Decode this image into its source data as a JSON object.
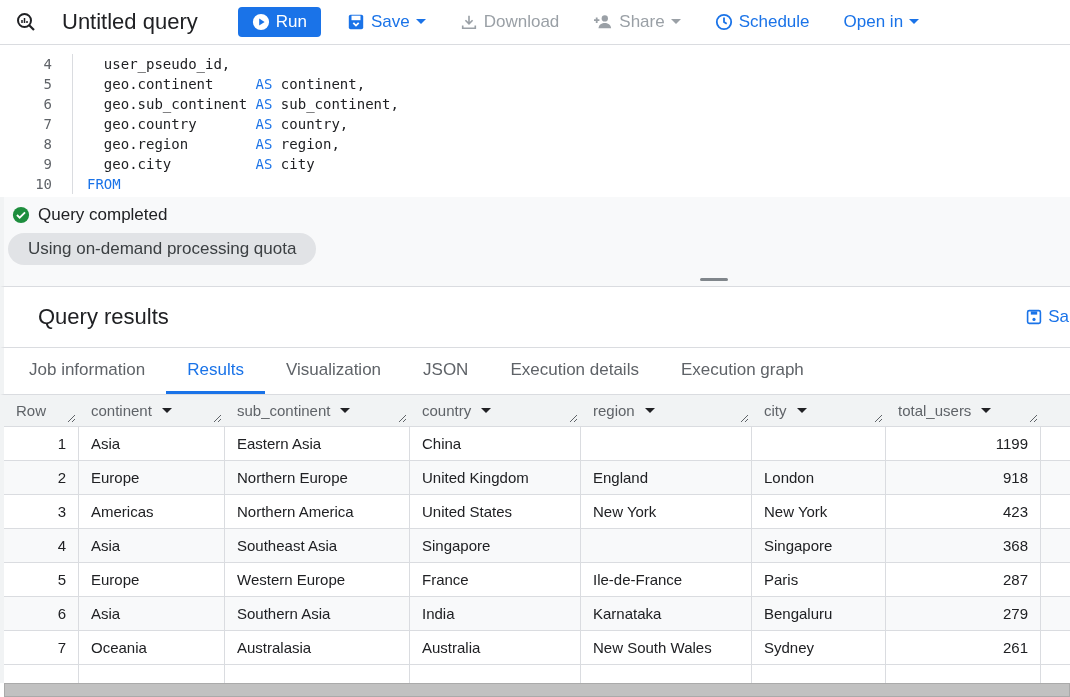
{
  "toolbar": {
    "title": "Untitled query",
    "buttons": [
      {
        "kind": "run",
        "label": "Run",
        "disabled": false,
        "caret": false
      },
      {
        "kind": "save",
        "label": "Save",
        "disabled": false,
        "caret": true
      },
      {
        "kind": "download",
        "label": "Download",
        "disabled": true,
        "caret": false
      },
      {
        "kind": "share",
        "label": "Share",
        "disabled": true,
        "caret": true
      },
      {
        "kind": "schedule",
        "label": "Schedule",
        "disabled": false,
        "caret": false
      },
      {
        "kind": "open",
        "label": "Open in",
        "disabled": false,
        "caret": true
      }
    ]
  },
  "editor": {
    "lines": [
      {
        "number": "4",
        "segments": [
          {
            "kind": "plain",
            "text": "  user_pseudo_id,"
          }
        ]
      },
      {
        "number": "5",
        "segments": [
          {
            "kind": "plain",
            "text": "  geo.continent     "
          },
          {
            "kind": "keyword",
            "text": "AS"
          },
          {
            "kind": "plain",
            "text": " continent,"
          }
        ]
      },
      {
        "number": "6",
        "segments": [
          {
            "kind": "plain",
            "text": "  geo.sub_continent "
          },
          {
            "kind": "keyword",
            "text": "AS"
          },
          {
            "kind": "plain",
            "text": " sub_continent,"
          }
        ]
      },
      {
        "number": "7",
        "segments": [
          {
            "kind": "plain",
            "text": "  geo.country       "
          },
          {
            "kind": "keyword",
            "text": "AS"
          },
          {
            "kind": "plain",
            "text": " country,"
          }
        ]
      },
      {
        "number": "8",
        "segments": [
          {
            "kind": "plain",
            "text": "  geo.region        "
          },
          {
            "kind": "keyword",
            "text": "AS"
          },
          {
            "kind": "plain",
            "text": " region,"
          }
        ]
      },
      {
        "number": "9",
        "segments": [
          {
            "kind": "plain",
            "text": "  geo.city          "
          },
          {
            "kind": "keyword",
            "text": "AS"
          },
          {
            "kind": "plain",
            "text": " city"
          }
        ]
      },
      {
        "number": "10",
        "segments": [
          {
            "kind": "keyword",
            "text": "FROM"
          }
        ]
      }
    ]
  },
  "status": {
    "message": "Query completed",
    "quota": "Using on-demand processing quota"
  },
  "results": {
    "title": "Query results",
    "save_label": "Sa",
    "tabs": [
      {
        "label": "Job information",
        "selected": false
      },
      {
        "label": "Results",
        "selected": true
      },
      {
        "label": "Visualization",
        "selected": false
      },
      {
        "label": "JSON",
        "selected": false
      },
      {
        "label": "Execution details",
        "selected": false
      },
      {
        "label": "Execution graph",
        "selected": false
      }
    ],
    "table": {
      "columns": [
        {
          "label": "Row",
          "sortable": false
        },
        {
          "label": "continent",
          "sortable": true
        },
        {
          "label": "sub_continent",
          "sortable": true
        },
        {
          "label": "country",
          "sortable": true
        },
        {
          "label": "region",
          "sortable": true
        },
        {
          "label": "city",
          "sortable": true
        },
        {
          "label": "total_users",
          "sortable": true
        }
      ],
      "rows": [
        [
          "1",
          "Asia",
          "Eastern Asia",
          "China",
          "",
          "",
          "1199"
        ],
        [
          "2",
          "Europe",
          "Northern Europe",
          "United Kingdom",
          "England",
          "London",
          "918"
        ],
        [
          "3",
          "Americas",
          "Northern America",
          "United States",
          "New York",
          "New York",
          "423"
        ],
        [
          "4",
          "Asia",
          "Southeast Asia",
          "Singapore",
          "",
          "Singapore",
          "368"
        ],
        [
          "5",
          "Europe",
          "Western Europe",
          "France",
          "Ile-de-France",
          "Paris",
          "287"
        ],
        [
          "6",
          "Asia",
          "Southern Asia",
          "India",
          "Karnataka",
          "Bengaluru",
          "279"
        ],
        [
          "7",
          "Oceania",
          "Australasia",
          "Australia",
          "New South Wales",
          "Sydney",
          "261"
        ]
      ]
    }
  }
}
